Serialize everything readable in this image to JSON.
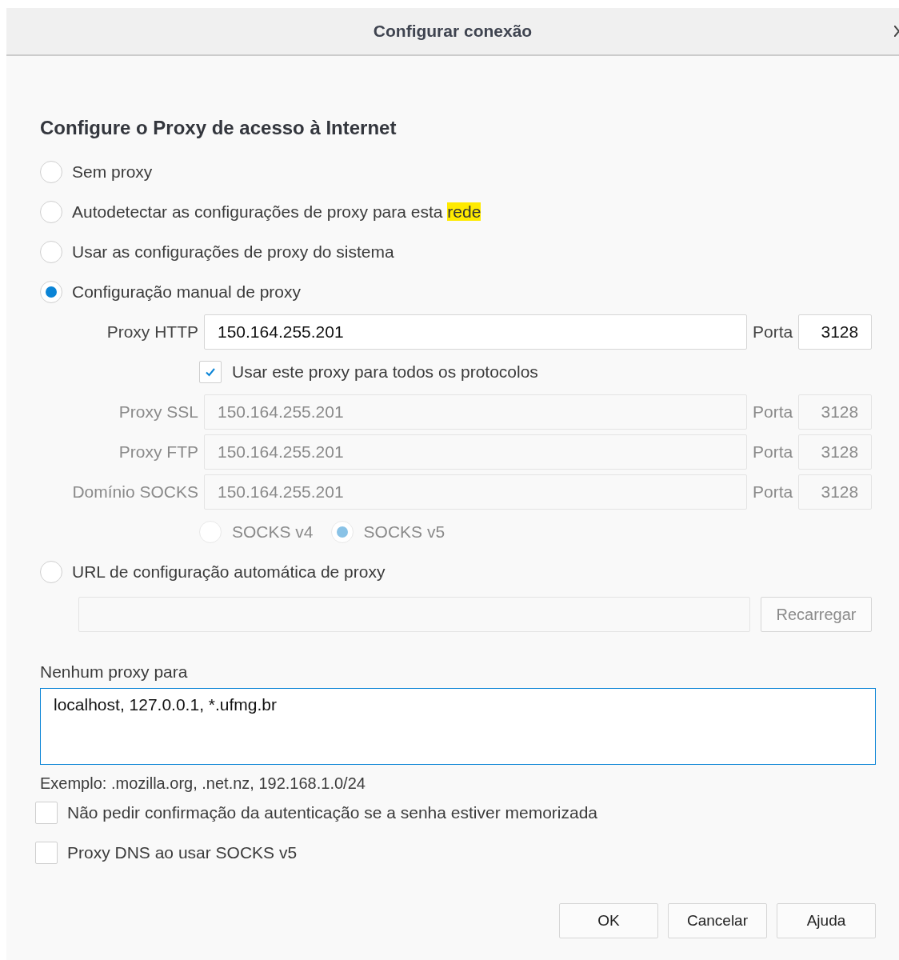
{
  "window": {
    "title": "Configurar conexão"
  },
  "heading": "Configure o Proxy de acesso à Internet",
  "proxy_modes": [
    {
      "kind": "none",
      "label": "Sem proxy",
      "selected": false
    },
    {
      "kind": "auto",
      "label": "Autodetectar as configurações de proxy para esta",
      "highlight": "rede",
      "selected": false
    },
    {
      "kind": "system",
      "label": "Usar as configurações de proxy do sistema",
      "selected": false
    },
    {
      "kind": "manual",
      "label": "Configuração manual de proxy",
      "selected": true
    },
    {
      "kind": "url",
      "label": "URL de configuração automática de proxy",
      "selected": false
    }
  ],
  "manual": {
    "proxies": [
      {
        "label": "Proxy HTTP",
        "value": "150.164.255.201",
        "port_label": "Porta",
        "port": "3128",
        "disabled": false
      },
      {
        "label": "Proxy SSL",
        "value": "150.164.255.201",
        "port_label": "Porta",
        "port": "3128",
        "disabled": true
      },
      {
        "label": "Proxy FTP",
        "value": "150.164.255.201",
        "port_label": "Porta",
        "port": "3128",
        "disabled": true
      },
      {
        "label": "Domínio SOCKS",
        "value": "150.164.255.201",
        "port_label": "Porta",
        "port": "3128",
        "disabled": true
      }
    ],
    "share_all": {
      "label": "Usar este proxy para todos os protocolos",
      "checked": true
    },
    "socks_versions": [
      {
        "label": "SOCKS v4",
        "selected": false
      },
      {
        "label": "SOCKS v5",
        "selected": true
      }
    ]
  },
  "url": {
    "button": "Recarregar",
    "disabled": true
  },
  "no_proxy": {
    "label": "Nenhum proxy para",
    "value": "localhost, 127.0.0.1, *.ufmg.br",
    "example": "Exemplo: .mozilla.org, .net.nz, 192.168.1.0/24"
  },
  "options": [
    {
      "label": "Não pedir confirmação da autenticação se a senha estiver memorizada",
      "checked": false
    },
    {
      "label": "Proxy DNS ao usar SOCKS v5",
      "checked": false
    }
  ],
  "buttons": [
    {
      "label": "OK"
    },
    {
      "label": "Cancelar"
    },
    {
      "label": "Ajuda"
    }
  ]
}
